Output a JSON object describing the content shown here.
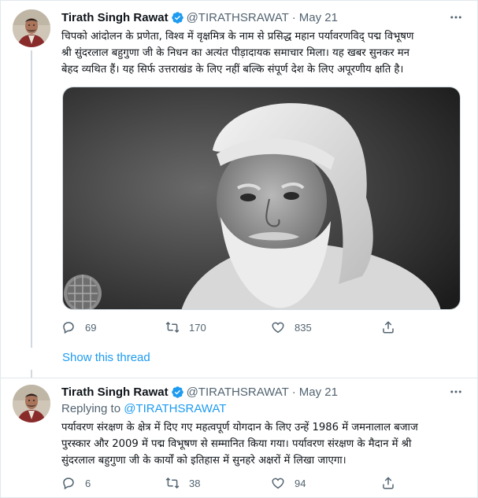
{
  "tweets": [
    {
      "name": "Tirath Singh Rawat",
      "handle": "@TIRATHSRAWAT",
      "separator": "·",
      "date": "May 21",
      "text_lines": [
        "चिपको आंदोलन के प्रणेता, विश्व में वृक्षमित्र के नाम से प्रसिद्ध महान पर्यावरणविद् पद्म विभूषण",
        "श्री सुंदरलाल बहुगुणा जी के निधन का अत्यंत पीड़ादायक समाचार मिला। यह खबर सुनकर मन",
        "बेहद व्यथित हैं। यह सिर्फ उत्तराखंड के लिए नहीं बल्कि संपूर्ण देश के लिए अपूरणीय क्षति है।"
      ],
      "replies": "69",
      "retweets": "170",
      "likes": "835"
    },
    {
      "name": "Tirath Singh Rawat",
      "handle": "@TIRATHSRAWAT",
      "separator": "·",
      "date": "May 21",
      "replying_prefix": "Replying to",
      "replying_handle": "@TIRATHSRAWAT",
      "text_lines": [
        "पर्यावरण संरक्षण के क्षेत्र में दिए गए महत्वपूर्ण योगदान के लिए उन्हें  1986 में जमनालाल बजाज",
        "पुरस्कार और 2009 में पद्म विभूषण से सम्मानित किया गया। पर्यावरण संरक्षण के मैदान में श्री",
        "सुंदरलाल बहुगुणा जी के कार्यों को इतिहास में सुनहरे अक्षरों में लिखा जाएगा।"
      ],
      "replies": "6",
      "retweets": "38",
      "likes": "94"
    }
  ],
  "show_thread_label": "Show this thread",
  "colors": {
    "accent": "#1d9bf0",
    "muted": "#536471",
    "text": "#0f1419",
    "border": "#e1e8ed"
  },
  "icons": [
    "verified-badge-icon",
    "more-icon",
    "reply-icon",
    "retweet-icon",
    "like-icon",
    "share-icon"
  ]
}
